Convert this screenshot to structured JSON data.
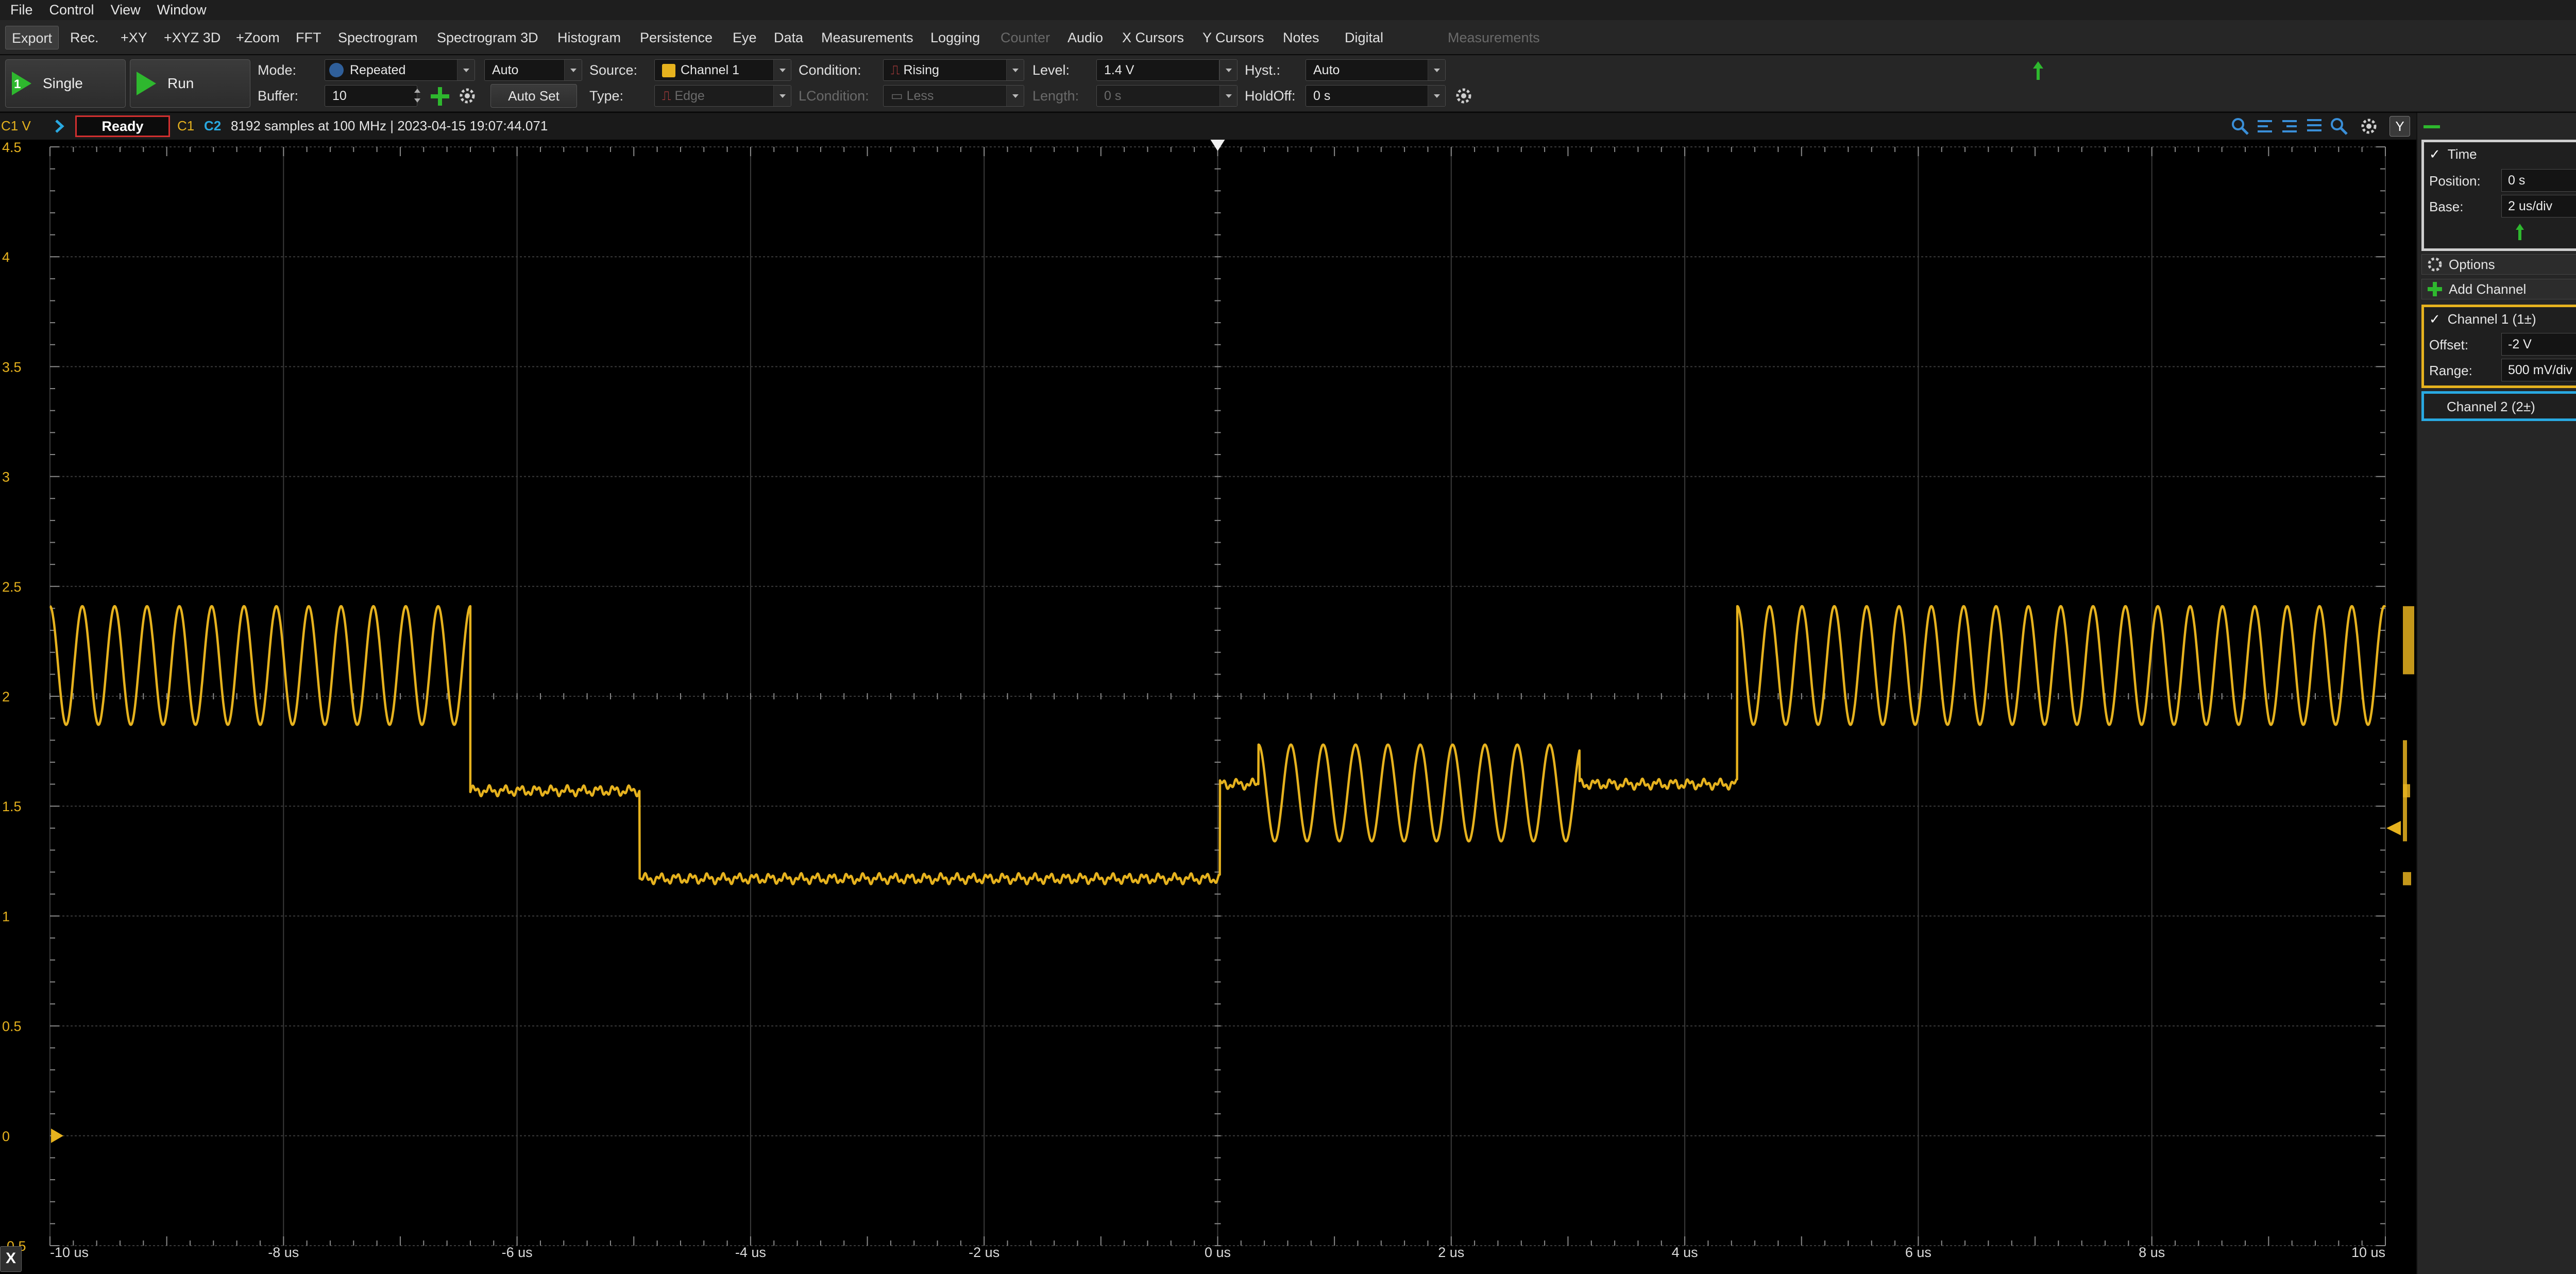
{
  "menu": [
    "File",
    "Control",
    "View",
    "Window"
  ],
  "tabs": [
    {
      "label": "Export",
      "active": true,
      "disabled": false
    },
    {
      "label": "Rec.",
      "active": false,
      "disabled": false
    },
    {
      "label": "+XY",
      "active": false,
      "disabled": false
    },
    {
      "label": "+XYZ 3D",
      "active": false,
      "disabled": false
    },
    {
      "label": "+Zoom",
      "active": false,
      "disabled": false
    },
    {
      "label": "FFT",
      "active": false,
      "disabled": false
    },
    {
      "label": "Spectrogram",
      "active": false,
      "disabled": false
    },
    {
      "label": "Spectrogram 3D",
      "active": false,
      "disabled": false
    },
    {
      "label": "Histogram",
      "active": false,
      "disabled": false
    },
    {
      "label": "Persistence",
      "active": false,
      "disabled": false
    },
    {
      "label": "Eye",
      "active": false,
      "disabled": false
    },
    {
      "label": "Data",
      "active": false,
      "disabled": false
    },
    {
      "label": "Measurements",
      "active": false,
      "disabled": false
    },
    {
      "label": "Logging",
      "active": false,
      "disabled": false
    },
    {
      "label": "Counter",
      "active": false,
      "disabled": true
    },
    {
      "label": "Audio",
      "active": false,
      "disabled": false
    },
    {
      "label": "X Cursors",
      "active": false,
      "disabled": false
    },
    {
      "label": "Y Cursors",
      "active": false,
      "disabled": false
    },
    {
      "label": "Notes",
      "active": false,
      "disabled": false
    },
    {
      "label": "Digital",
      "active": false,
      "disabled": false
    },
    {
      "label": "Measurements",
      "active": false,
      "disabled": true
    }
  ],
  "toolbar": {
    "single_label": "Single",
    "single_badge": "1",
    "run_label": "Run",
    "mode_label": "Mode:",
    "mode_value": "Repeated",
    "mode_auto": "Auto",
    "buffer_label": "Buffer:",
    "buffer_value": "10",
    "autoset_label": "Auto Set",
    "source_label": "Source:",
    "source_value": "Channel 1",
    "type_label": "Type:",
    "type_value": "Edge",
    "condition_label": "Condition:",
    "condition_value": "Rising",
    "lcondition_label": "LCondition:",
    "lcondition_value": "Less",
    "level_label": "Level:",
    "level_value": "1.4 V",
    "length_label": "Length:",
    "length_value": "0 s",
    "hyst_label": "Hyst.:",
    "hyst_value": "Auto",
    "holdoff_label": "HoldOff:",
    "holdoff_value": "0 s"
  },
  "status": {
    "c1_axis_label": "C1 V",
    "state": "Ready",
    "c1": "C1",
    "c2": "C2",
    "info": "8192 samples at 100 MHz | 2023-04-15 19:07:44.071"
  },
  "colors": {
    "channel1": "#e6b21e",
    "channel2": "#29a9e1",
    "time_box": "#cfcfcf",
    "ready_border": "#d23030",
    "grid": "#3a3a3a"
  },
  "right_panel": {
    "y_button": "Y",
    "time": {
      "title": "Time",
      "position_label": "Position:",
      "position_value": "0 s",
      "base_label": "Base:",
      "base_value": "2 us/div"
    },
    "options_label": "Options",
    "add_channel_label": "Add Channel",
    "channel1": {
      "title": "Channel 1 (1±)",
      "offset_label": "Offset:",
      "offset_value": "-2 V",
      "range_label": "Range:",
      "range_value": "500 mV/div"
    },
    "channel2": {
      "title": "Channel 2 (2±)"
    }
  },
  "x_axis_button": "X",
  "chart_data": {
    "type": "line",
    "title": "",
    "xlabel": "",
    "ylabel": "C1 V",
    "x_unit": "us",
    "xlim": [
      -10,
      10
    ],
    "ylim": [
      -0.5,
      4.5
    ],
    "x_ticks": [
      "-10 us",
      "-8 us",
      "-6 us",
      "-4 us",
      "-2 us",
      "0 us",
      "2 us",
      "4 us",
      "6 us",
      "8 us",
      "10 us"
    ],
    "y_ticks": [
      "4.5",
      "4",
      "3.5",
      "3",
      "2.5",
      "2",
      "1.5",
      "1",
      "0.5",
      "0",
      "-0.5"
    ],
    "grid": true,
    "trigger_level": 1.4,
    "trigger_time": 0,
    "series": [
      {
        "name": "C1",
        "color": "#e6b21e",
        "segments": [
          {
            "t_start": -10.0,
            "t_end": -6.4,
            "kind": "oscillation",
            "center": 2.14,
            "amplitude": 0.27,
            "period": 0.277
          },
          {
            "t_start": -6.4,
            "t_end": -4.95,
            "kind": "flat",
            "level": 1.57
          },
          {
            "t_start": -4.95,
            "t_end": 0.02,
            "kind": "flat",
            "level": 1.17
          },
          {
            "t_start": 0.02,
            "t_end": 0.35,
            "kind": "flat",
            "level": 1.6
          },
          {
            "t_start": 0.35,
            "t_end": 3.1,
            "kind": "oscillation",
            "center": 1.56,
            "amplitude": 0.22,
            "period": 0.277
          },
          {
            "t_start": 3.1,
            "t_end": 4.45,
            "kind": "flat",
            "level": 1.6
          },
          {
            "t_start": 4.45,
            "t_end": 10.0,
            "kind": "oscillation",
            "center": 2.14,
            "amplitude": 0.27,
            "period": 0.277
          }
        ]
      }
    ]
  }
}
